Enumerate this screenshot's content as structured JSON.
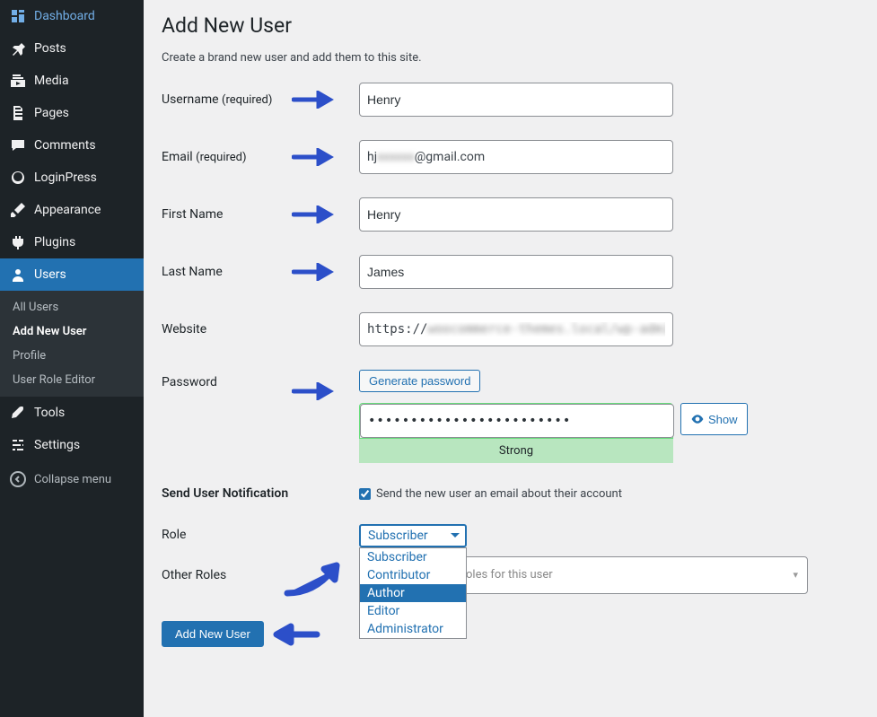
{
  "sidebar": {
    "items": [
      {
        "label": "Dashboard",
        "icon": "dashboard"
      },
      {
        "label": "Posts",
        "icon": "pin"
      },
      {
        "label": "Media",
        "icon": "media"
      },
      {
        "label": "Pages",
        "icon": "page"
      },
      {
        "label": "Comments",
        "icon": "comment"
      },
      {
        "label": "LoginPress",
        "icon": "loginpress"
      },
      {
        "label": "Appearance",
        "icon": "brush"
      },
      {
        "label": "Plugins",
        "icon": "plugin"
      },
      {
        "label": "Users",
        "icon": "user",
        "current": true
      },
      {
        "label": "Tools",
        "icon": "wrench"
      },
      {
        "label": "Settings",
        "icon": "settings"
      }
    ],
    "submenu": [
      {
        "label": "All Users"
      },
      {
        "label": "Add New User",
        "current": true
      },
      {
        "label": "Profile"
      },
      {
        "label": "User Role Editor"
      }
    ],
    "collapse": "Collapse menu"
  },
  "page": {
    "title": "Add New User",
    "intro": "Create a brand new user and add them to this site."
  },
  "fields": {
    "username": {
      "label": "Username",
      "req": "(required)",
      "value": "Henry"
    },
    "email": {
      "label": "Email",
      "req": "(required)",
      "value_prefix": "hj",
      "value_suffix": "@gmail.com",
      "value_blur": "xxxxxx"
    },
    "first_name": {
      "label": "First Name",
      "value": "Henry"
    },
    "last_name": {
      "label": "Last Name",
      "value": "James"
    },
    "website": {
      "label": "Website",
      "value_prefix": "https://",
      "value_blur": "woocommerce-themes.local/wp-admin/c"
    },
    "password": {
      "label": "Password",
      "generate": "Generate password",
      "masked": "••••••••••••••••••••••••",
      "strength": "Strong",
      "show": "Show"
    },
    "notify": {
      "label": "Send User Notification",
      "checkbox_label": "Send the new user an email about their account",
      "checked": true
    },
    "role": {
      "label": "Role",
      "selected": "Subscriber",
      "options": [
        "Subscriber",
        "Contributor",
        "Author",
        "Editor",
        "Administrator"
      ],
      "highlighted": "Author"
    },
    "other_roles": {
      "label": "Other Roles",
      "placeholder": "oles for this user"
    }
  },
  "submit": {
    "label": "Add New User"
  }
}
